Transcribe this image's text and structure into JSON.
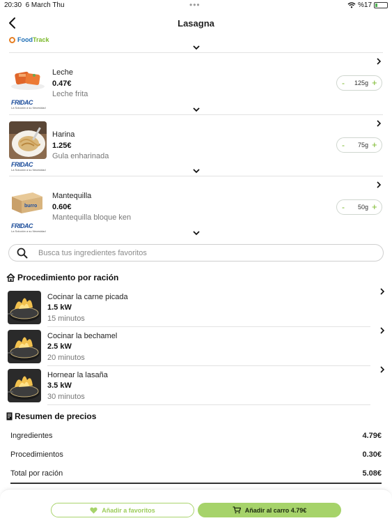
{
  "status_bar": {
    "time": "20:30",
    "date": "6 March Thu",
    "dots": "•••",
    "battery_text": "%17",
    "battery_level": 0.17
  },
  "header": {
    "title": "Lasagna"
  },
  "provider": {
    "name_part1": "Food",
    "name_part2": "Track"
  },
  "ingredients": [
    {
      "name": "Leche",
      "price": "0.47€",
      "description": "Leche frita",
      "quantity": "125",
      "unit": "g",
      "minus": "-",
      "plus": "+",
      "brand": "FRIDAC",
      "brand_tagline": "La Solución a su Necesidad"
    },
    {
      "name": "Harina",
      "price": "1.25€",
      "description": "Gula enharinada",
      "quantity": "75",
      "unit": "g",
      "minus": "-",
      "plus": "+",
      "brand": "FRIDAC",
      "brand_tagline": "La Solución a su Necesidad"
    },
    {
      "name": "Mantequilla",
      "price": "0.60€",
      "description": "Mantequilla bloque  ken",
      "quantity": "50",
      "unit": "g",
      "minus": "-",
      "plus": "+",
      "brand": "FRIDAC",
      "brand_tagline": "La Solución a su Necesidad",
      "box_label": "burro"
    }
  ],
  "search": {
    "placeholder": "Busca tus ingredientes favoritos"
  },
  "procedures": {
    "title": "Procedimiento por ración",
    "items": [
      {
        "name": "Cocinar la carne picada",
        "power": "1.5 kW",
        "time": "15 minutos"
      },
      {
        "name": "Cocinar la bechamel",
        "power": "2.5 kW",
        "time": "20 minutos"
      },
      {
        "name": "Hornear la lasaña",
        "power": "3.5 kW",
        "time": "30 minutos"
      }
    ]
  },
  "prices": {
    "title": "Resumen de precios",
    "rows": [
      {
        "label": "Ingredientes",
        "value": "4.79€"
      },
      {
        "label": "Procedimientos",
        "value": "0.30€"
      },
      {
        "label": "Total por ración",
        "value": "5.08€"
      }
    ]
  },
  "actions": {
    "favorites_label": "Añadir a favoritos",
    "cart_label": "Añadir al carro 4.79€"
  },
  "colors": {
    "accent_green": "#a6d36a",
    "food_blue": "#1f6fb6",
    "track_green": "#7ab829"
  }
}
